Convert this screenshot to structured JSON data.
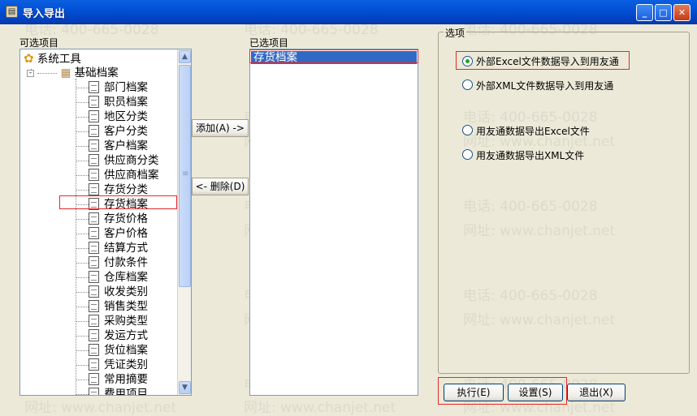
{
  "window": {
    "title": "导入导出",
    "min_glyph": "_",
    "max_glyph": "□",
    "close_glyph": "✕"
  },
  "left_panel": {
    "label": "可选项目"
  },
  "tree": {
    "root": "系统工具",
    "group": "基础档案",
    "expander": "-",
    "items": [
      "部门档案",
      "职员档案",
      "地区分类",
      "客户分类",
      "客户档案",
      "供应商分类",
      "供应商档案",
      "存货分类",
      "存货档案",
      "存货价格",
      "客户价格",
      "结算方式",
      "付款条件",
      "仓库档案",
      "收发类别",
      "销售类型",
      "采购类型",
      "发运方式",
      "货位档案",
      "凭证类别",
      "常用摘要",
      "费用项目"
    ],
    "highlighted_item": "存货档案"
  },
  "buttons": {
    "add": "添加(A) ->",
    "remove": "<- 删除(D)",
    "execute": "执行(E)",
    "settings": "设置(S)",
    "exit": "退出(X)"
  },
  "selected_panel": {
    "label": "已选项目",
    "items": [
      "存货档案"
    ]
  },
  "options": {
    "label": "选项",
    "radios": [
      {
        "label": "外部Excel文件数据导入到用友通",
        "checked": true
      },
      {
        "label": "外部XML文件数据导入到用友通",
        "checked": false
      },
      {
        "label": "用友通数据导出Excel文件",
        "checked": false
      },
      {
        "label": "用友通数据导出XML文件",
        "checked": false
      }
    ]
  },
  "watermark": {
    "phone": "电话: 400-665-0028",
    "site": "网址: www.chanjet.net"
  },
  "scroll_arrows": {
    "up": "▲",
    "down": "▼",
    "grip": "≡"
  },
  "colors": {
    "title_bar": "#0351D6",
    "selection": "#316AC5",
    "highlight_box": "#E52A2A",
    "face": "#ECE9D8"
  }
}
